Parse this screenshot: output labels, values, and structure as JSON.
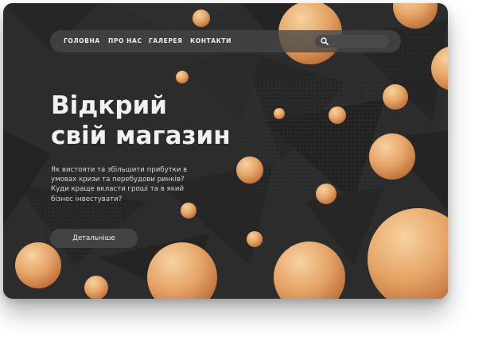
{
  "nav": {
    "items": [
      {
        "label": "ГОЛОВНА"
      },
      {
        "label": "ПРО НАС"
      },
      {
        "label": "ГАЛЕРЕЯ"
      },
      {
        "label": "КОНТАКТИ"
      }
    ],
    "search_icon": "search-icon"
  },
  "hero": {
    "title_line1": "Відкрий",
    "title_line2": "свій магазин",
    "description_lines": [
      "Як вистояти та збільшити прибутки в",
      "умовах кризи та перебудови ринків?",
      "Куди краще вкласти гроші та в який",
      "бізнес інвестувати?"
    ],
    "button_label": "Детальніше"
  },
  "colors": {
    "background": "#2c2c2c",
    "sphere_light": "#f6c98e",
    "sphere_dark": "#c7743c",
    "text": "#f1f1f1"
  }
}
